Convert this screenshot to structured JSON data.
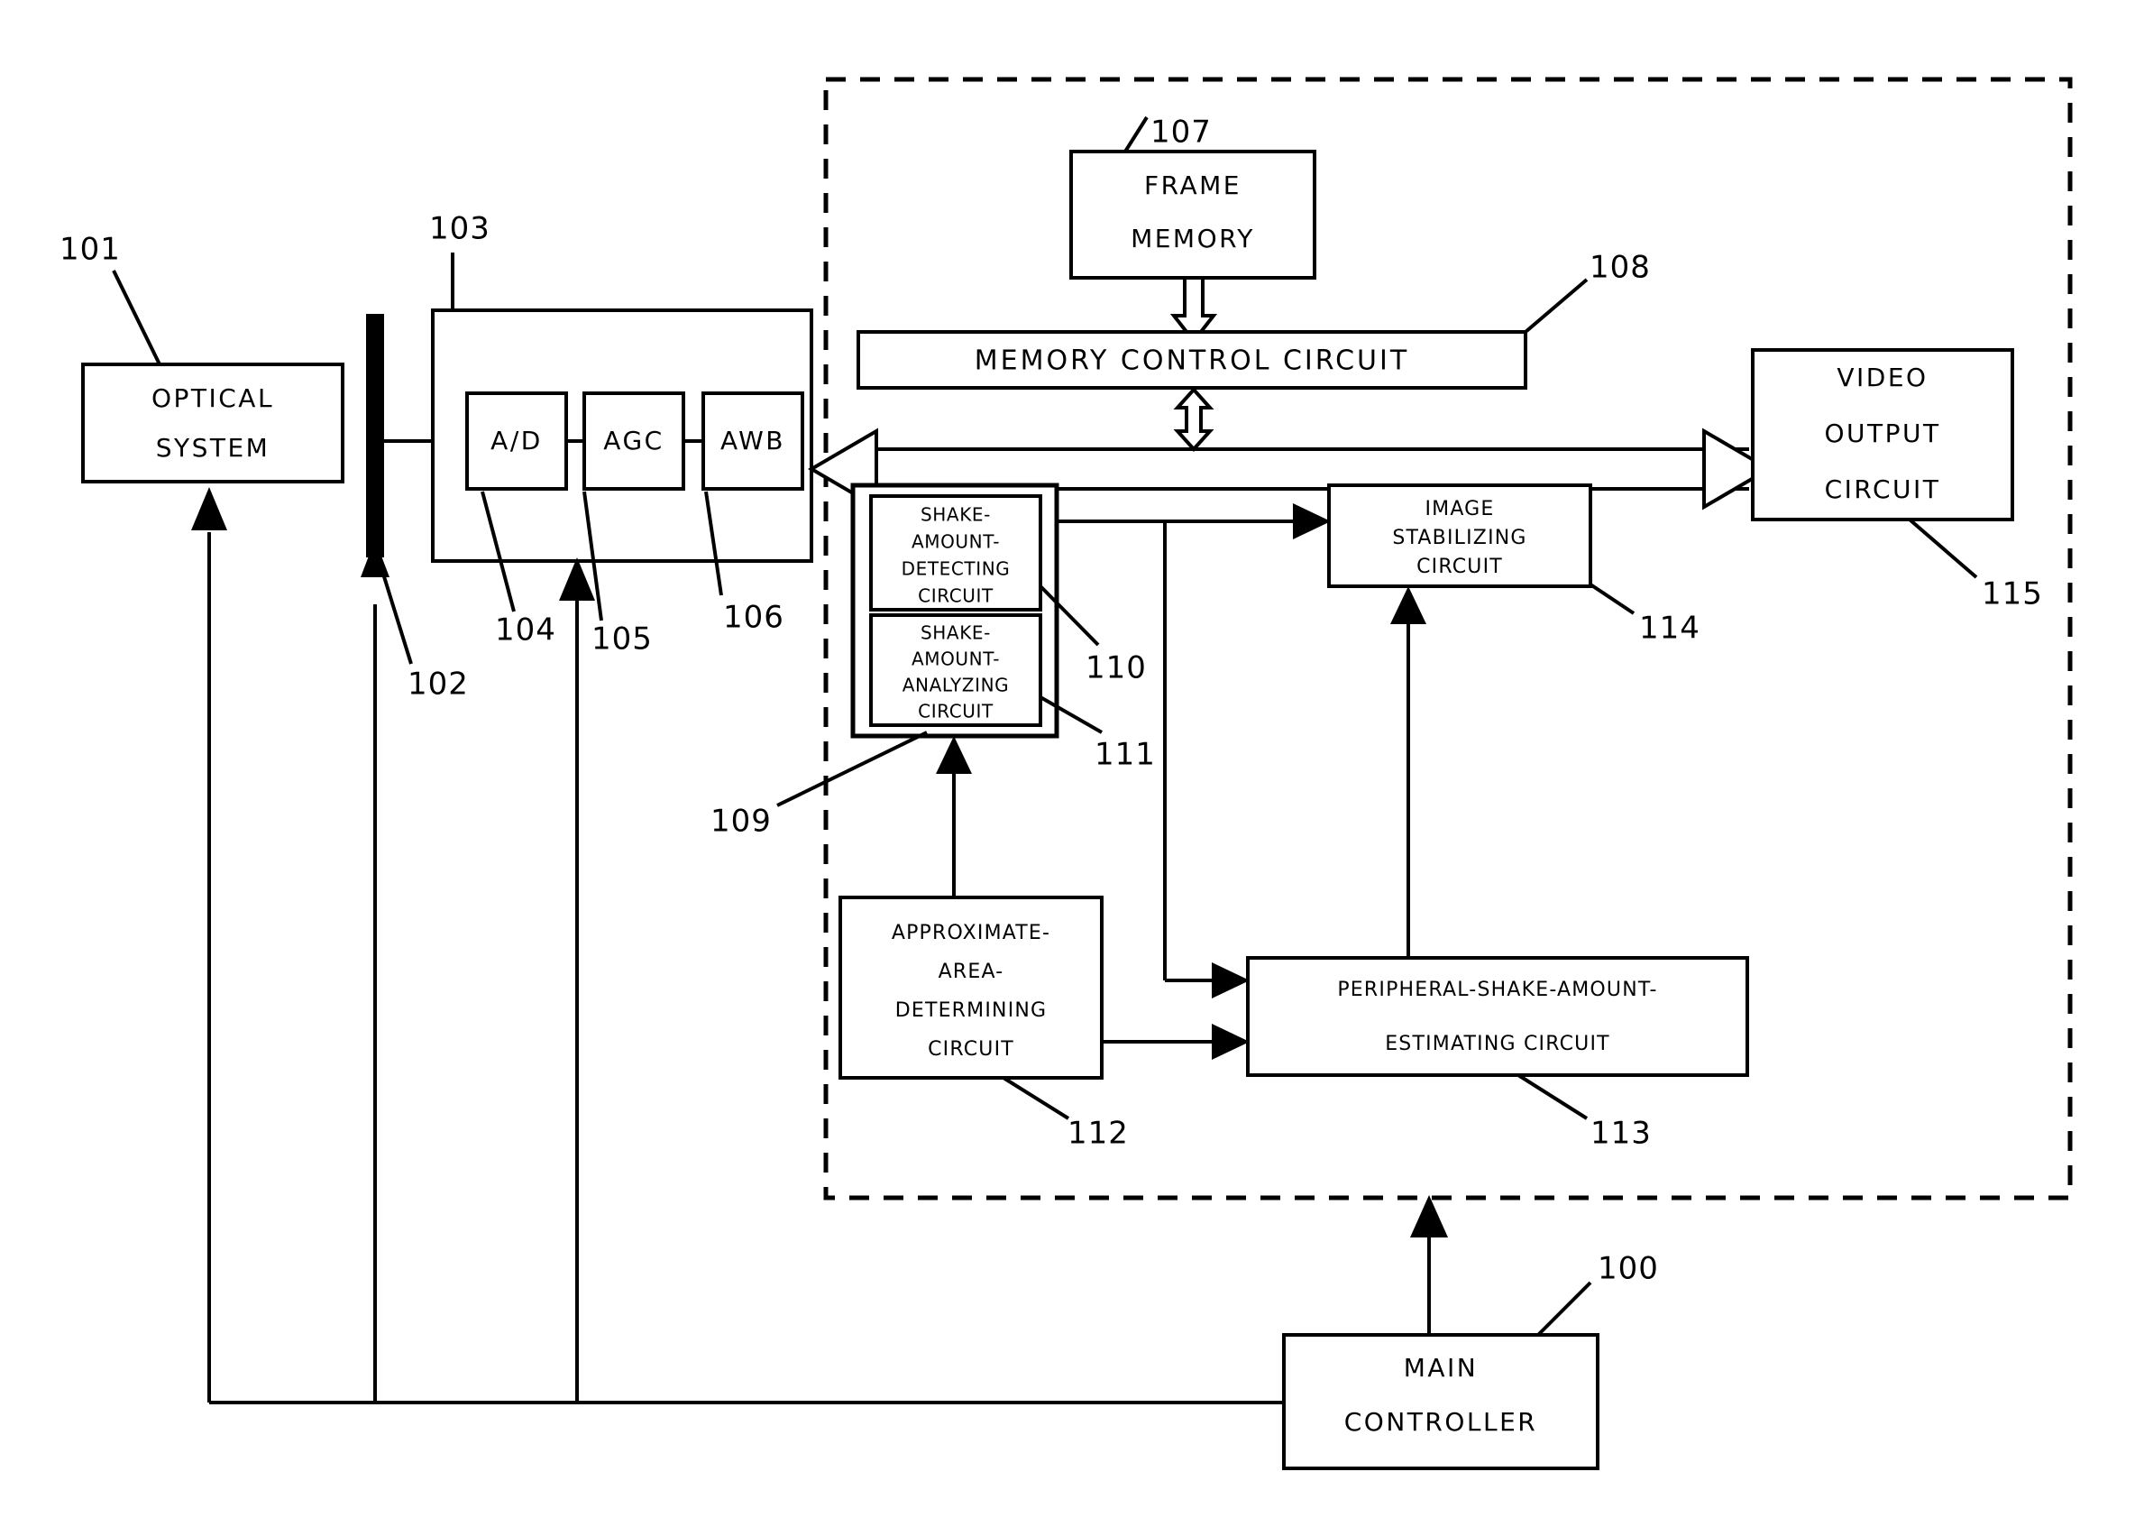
{
  "figure": {
    "type": "patent-block-diagram",
    "boxes": [
      {
        "id": "101",
        "name": "optical-system",
        "lines": [
          "OPTICAL",
          "SYSTEM"
        ]
      },
      {
        "id": "103",
        "name": "signal-processing-block",
        "lines": []
      },
      {
        "id": "104",
        "name": "ad-converter",
        "lines": [
          "A/D"
        ]
      },
      {
        "id": "105",
        "name": "agc",
        "lines": [
          "AGC"
        ]
      },
      {
        "id": "106",
        "name": "awb",
        "lines": [
          "AWB"
        ]
      },
      {
        "id": "107",
        "name": "frame-memory",
        "lines": [
          "FRAME",
          "MEMORY"
        ]
      },
      {
        "id": "108",
        "name": "memory-control-circuit",
        "lines": [
          "MEMORY CONTROL CIRCUIT"
        ]
      },
      {
        "id": "109",
        "name": "shake-amount-block",
        "lines": []
      },
      {
        "id": "110",
        "name": "shake-amount-detecting-circuit",
        "lines": [
          "SHAKE-",
          "AMOUNT-",
          "DETECTING",
          "CIRCUIT"
        ]
      },
      {
        "id": "111",
        "name": "shake-amount-analyzing-circuit",
        "lines": [
          "SHAKE-",
          "AMOUNT-",
          "ANALYZING",
          "CIRCUIT"
        ]
      },
      {
        "id": "112",
        "name": "approximate-area-determining-circuit",
        "lines": [
          "APPROXIMATE-",
          "AREA-",
          "DETERMINING",
          "CIRCUIT"
        ]
      },
      {
        "id": "113",
        "name": "peripheral-shake-amount-estimating-circuit",
        "lines": [
          "PERIPHERAL-SHAKE-AMOUNT-",
          "ESTIMATING CIRCUIT"
        ]
      },
      {
        "id": "114",
        "name": "image-stabilizing-circuit",
        "lines": [
          "IMAGE",
          "STABILIZING",
          "CIRCUIT"
        ]
      },
      {
        "id": "115",
        "name": "video-output-circuit",
        "lines": [
          "VIDEO",
          "OUTPUT",
          "CIRCUIT"
        ]
      },
      {
        "id": "100",
        "name": "main-controller",
        "lines": [
          "MAIN",
          "CONTROLLER"
        ]
      },
      {
        "id": "102",
        "name": "image-sensor",
        "lines": []
      }
    ],
    "reference_numerals": [
      "100",
      "101",
      "102",
      "103",
      "104",
      "105",
      "106",
      "107",
      "108",
      "109",
      "110",
      "111",
      "112",
      "113",
      "114",
      "115"
    ],
    "labels": {
      "optical_system_l1": "OPTICAL",
      "optical_system_l2": "SYSTEM",
      "ad": "A/D",
      "agc": "AGC",
      "awb": "AWB",
      "frame_memory_l1": "FRAME",
      "frame_memory_l2": "MEMORY",
      "memory_control": "MEMORY CONTROL CIRCUIT",
      "sad_l1": "SHAKE-",
      "sad_l2": "AMOUNT-",
      "sad_l3": "DETECTING",
      "sad_l4": "CIRCUIT",
      "saa_l1": "SHAKE-",
      "saa_l2": "AMOUNT-",
      "saa_l3": "ANALYZING",
      "saa_l4": "CIRCUIT",
      "aad_l1": "APPROXIMATE-",
      "aad_l2": "AREA-",
      "aad_l3": "DETERMINING",
      "aad_l4": "CIRCUIT",
      "psae_l1": "PERIPHERAL-SHAKE-AMOUNT-",
      "psae_l2": "ESTIMATING CIRCUIT",
      "isc_l1": "IMAGE",
      "isc_l2": "STABILIZING",
      "isc_l3": "CIRCUIT",
      "voc_l1": "VIDEO",
      "voc_l2": "OUTPUT",
      "voc_l3": "CIRCUIT",
      "mc_l1": "MAIN",
      "mc_l2": "CONTROLLER",
      "ref_100": "100",
      "ref_101": "101",
      "ref_102": "102",
      "ref_103": "103",
      "ref_104": "104",
      "ref_105": "105",
      "ref_106": "106",
      "ref_107": "107",
      "ref_108": "108",
      "ref_109": "109",
      "ref_110": "110",
      "ref_111": "111",
      "ref_112": "112",
      "ref_113": "113",
      "ref_114": "114",
      "ref_115": "115"
    },
    "colors": {
      "stroke": "#000000",
      "fill": "#ffffff",
      "sensor": "#000000"
    }
  }
}
